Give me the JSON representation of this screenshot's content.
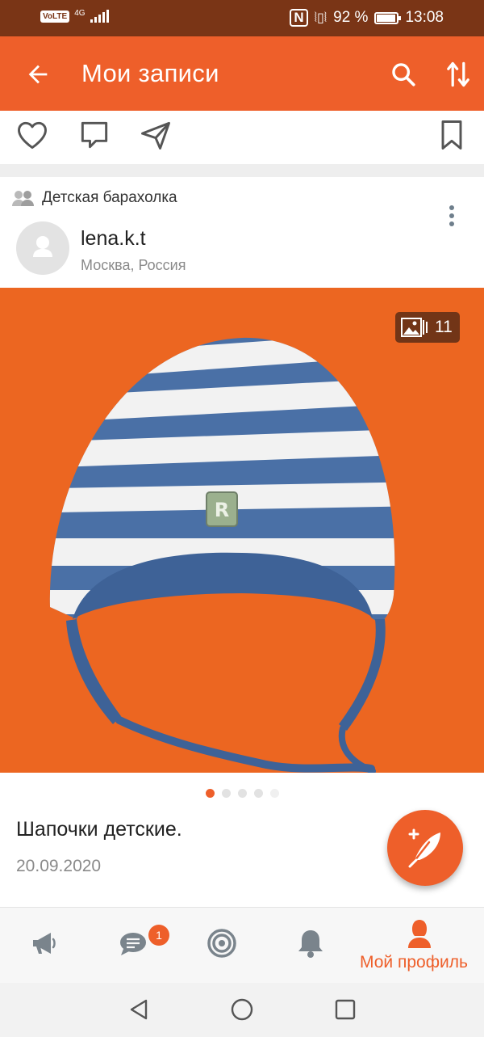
{
  "status_bar": {
    "network": "VoLTE",
    "network_type": "4G",
    "battery": "92 %",
    "time": "13:08"
  },
  "app_bar": {
    "title": "Мои записи",
    "back_icon": "arrow-left-icon",
    "search_icon": "search-icon",
    "sort_icon": "sort-icon"
  },
  "post": {
    "group": "Детская барахолка",
    "author": "lena.k.t",
    "location": "Москва, Россия",
    "photo_count": "11",
    "title": "Шапочки детские.",
    "date": "20.09.2020",
    "carousel": {
      "total": 5,
      "active": 1
    }
  },
  "tabs": [
    {
      "name": "feed",
      "icon": "megaphone-icon"
    },
    {
      "name": "messages",
      "icon": "chat-icon",
      "badge": "1"
    },
    {
      "name": "discussions",
      "icon": "target-icon"
    },
    {
      "name": "notifications",
      "icon": "bell-icon"
    },
    {
      "name": "profile",
      "icon": "profile-icon",
      "label": "Мой профиль",
      "active": true
    }
  ],
  "colors": {
    "accent": "#ee5f2a",
    "status_bar": "#7a3516",
    "photo_bg": "#ec6621"
  }
}
